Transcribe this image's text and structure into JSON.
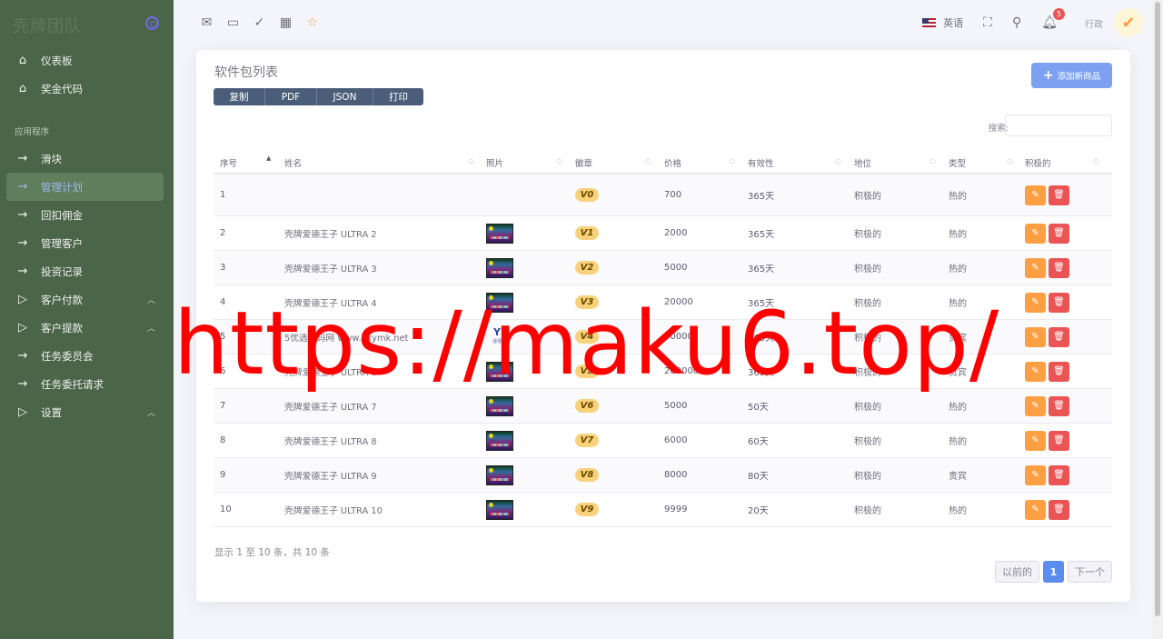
{
  "sidebar": {
    "brand": "壳牌团队",
    "top_items": [
      {
        "icon": "home-icon",
        "label": "仪表板"
      },
      {
        "icon": "home-icon",
        "label": "奖金代码"
      }
    ],
    "section": "应用程序",
    "items": [
      {
        "icon": "arrow-right-icon",
        "label": "滑块"
      },
      {
        "icon": "arrow-right-icon",
        "label": "管理计划",
        "active": true
      },
      {
        "icon": "arrow-right-icon",
        "label": "回扣佣金"
      },
      {
        "icon": "arrow-right-icon",
        "label": "管理客户"
      },
      {
        "icon": "arrow-right-icon",
        "label": "投资记录"
      },
      {
        "icon": "play-icon",
        "label": "客户付款",
        "expandable": true
      },
      {
        "icon": "play-icon",
        "label": "客户提款",
        "expandable": true
      },
      {
        "icon": "arrow-right-icon",
        "label": "任务委员会"
      },
      {
        "icon": "arrow-right-icon",
        "label": "任务委托请求"
      },
      {
        "icon": "play-icon",
        "label": "设置",
        "expandable": true
      }
    ]
  },
  "topbar": {
    "language": "英语",
    "notification_count": "5",
    "user_role": "行政"
  },
  "card": {
    "title": "软件包列表",
    "add_button": "添加新商品",
    "export_buttons": [
      "复制",
      "PDF",
      "JSON",
      "打印"
    ],
    "search_label": "搜索:",
    "search_value": ""
  },
  "table": {
    "headers": [
      "序号",
      "姓名",
      "照片",
      "徽章",
      "价格",
      "有效性",
      "地位",
      "类型",
      "积极的"
    ],
    "rows": [
      {
        "id": "1",
        "name": "",
        "photo": "none",
        "badge": "V0",
        "price": "700",
        "validity": "365天",
        "status": "积极的",
        "type": "热的"
      },
      {
        "id": "2",
        "name": "壳牌爱德王子 ULTRA 2",
        "photo": "game",
        "badge": "V1",
        "price": "2000",
        "validity": "365天",
        "status": "积极的",
        "type": "热的"
      },
      {
        "id": "3",
        "name": "壳牌爱德王子 ULTRA 3",
        "photo": "game",
        "badge": "V2",
        "price": "5000",
        "validity": "365天",
        "status": "积极的",
        "type": "热的"
      },
      {
        "id": "4",
        "name": "壳牌爱德王子 ULTRA 4",
        "photo": "game",
        "badge": "V3",
        "price": "20000",
        "validity": "365天",
        "status": "积极的",
        "type": "热的"
      },
      {
        "id": "5",
        "name": "5优选源码网 www.yxymk.net",
        "photo": "logo",
        "badge": "V4",
        "price": "50000",
        "validity": "365天",
        "status": "积极的",
        "type": "贵宾"
      },
      {
        "id": "6",
        "name": "壳牌爱德王子 ULTRA 6",
        "photo": "game",
        "badge": "V5",
        "price": "200000",
        "validity": "365天",
        "status": "积极的",
        "type": "贵宾"
      },
      {
        "id": "7",
        "name": "壳牌爱德王子 ULTRA 7",
        "photo": "game",
        "badge": "V6",
        "price": "5000",
        "validity": "50天",
        "status": "积极的",
        "type": "热的"
      },
      {
        "id": "8",
        "name": "壳牌爱德王子 ULTRA 8",
        "photo": "game",
        "badge": "V7",
        "price": "6000",
        "validity": "60天",
        "status": "积极的",
        "type": "热的"
      },
      {
        "id": "9",
        "name": "壳牌爱德王子 ULTRA 9",
        "photo": "game",
        "badge": "V8",
        "price": "8000",
        "validity": "80天",
        "status": "积极的",
        "type": "贵宾"
      },
      {
        "id": "10",
        "name": "壳牌爱德王子 ULTRA 10",
        "photo": "game",
        "badge": "V9",
        "price": "9999",
        "validity": "20天",
        "status": "积极的",
        "type": "热的"
      }
    ]
  },
  "footer": {
    "info": "显示 1 至 10 条，共 10 条",
    "prev": "以前的",
    "current_page": "1",
    "next": "下一个"
  },
  "watermark": "https://maku6.top/",
  "colors": {
    "sidebar_bg": "#4a6548",
    "primary": "#7da1f0",
    "edit": "#ff9f43",
    "delete": "#ea5455",
    "badge": "#f7d27a",
    "watermark": "#ff0000"
  }
}
